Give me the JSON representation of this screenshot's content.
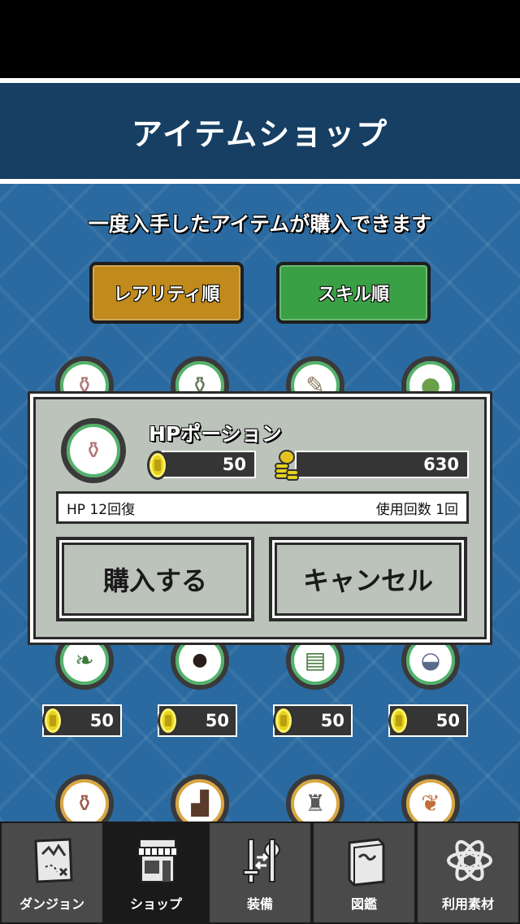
{
  "header": {
    "title": "アイテムショップ"
  },
  "shop": {
    "subtitle": "一度入手したアイテムが購入できます",
    "sort_rarity": "レアリティ順",
    "sort_skill": "スキル順",
    "row2_prices": [
      "50",
      "50",
      "50",
      "50"
    ]
  },
  "modal": {
    "item_name": "HPポーション",
    "price": "50",
    "money": "630",
    "effect": "HP 12回復",
    "uses": "使用回数 1回",
    "buy_label": "購入する",
    "cancel_label": "キャンセル"
  },
  "nav": {
    "items": [
      {
        "label": "ダンジョン",
        "icon": "map-icon"
      },
      {
        "label": "ショップ",
        "icon": "shop-icon"
      },
      {
        "label": "装備",
        "icon": "equipment-icon"
      },
      {
        "label": "図鑑",
        "icon": "book-icon"
      },
      {
        "label": "利用素材",
        "icon": "atom-icon"
      }
    ],
    "active_index": 1
  },
  "colors": {
    "header": "#163f63",
    "background": "#2a6aa0",
    "rarity_button": "#c08a1c",
    "skill_button": "#3aa046"
  }
}
